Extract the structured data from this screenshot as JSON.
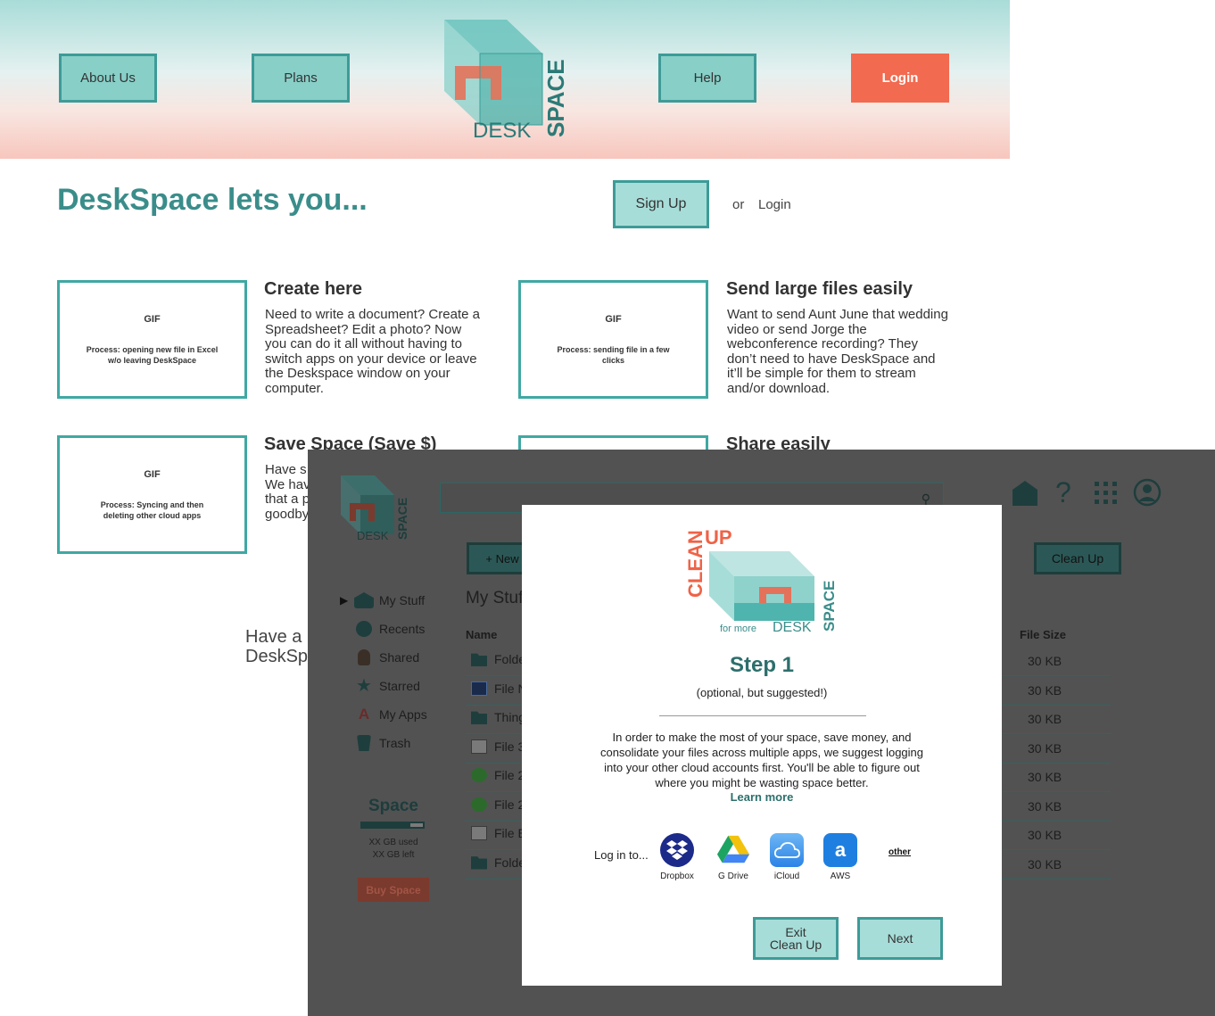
{
  "nav": {
    "about": "About Us",
    "plans": "Plans",
    "help": "Help",
    "login": "Login"
  },
  "logo": {
    "word_a": "DESK",
    "word_b": "SPACE"
  },
  "hero": {
    "title": "DeskSpace lets you...",
    "signup": "Sign Up",
    "or": "or",
    "login": "Login"
  },
  "features": [
    {
      "title": "Create here",
      "text": "Need to write a document? Create a Spreadsheet? Edit a photo? Now you can do it all without having to switch apps on your device or leave the Deskspace window on your computer.",
      "gif_label": "GIF",
      "gif_caption": "Process: opening new file in Excel w/o leaving DeskSpace"
    },
    {
      "title": "Send large files easily",
      "text": "Want to send Aunt June that wedding video or send Jorge the webconference recording? They don’t need to have DeskSpace and it’ll be simple for them to stream and/or download.",
      "gif_label": "GIF",
      "gif_caption": "Process: sending file in a few clicks"
    },
    {
      "title": "Save Space (Save $)",
      "text": "Have s\nWe hav\nthat a p\ngoodby",
      "gif_label": "GIF",
      "gif_caption": "Process: Syncing and then deleting other cloud apps"
    },
    {
      "title": "Share easily"
    }
  ],
  "have_text": "Have a\nDeskSp",
  "app": {
    "new_button": "+ New",
    "cleanup_button": "Clean Up",
    "sidebar": [
      {
        "label": "My Stuff",
        "icon": "home-icon"
      },
      {
        "label": "Recents",
        "icon": "clock-icon"
      },
      {
        "label": "Shared",
        "icon": "person-icon"
      },
      {
        "label": "Starred",
        "icon": "star-icon"
      },
      {
        "label": "My Apps",
        "icon": "apps-icon"
      },
      {
        "label": "Trash",
        "icon": "trash-icon"
      }
    ],
    "section_title": "My Stuff",
    "col_name": "Name",
    "col_size": "File Size",
    "rows": [
      {
        "name": "Folde",
        "size": "30 KB",
        "icon": "folder-icon"
      },
      {
        "name": "File N",
        "size": "30 KB",
        "icon": "photoshop-file-icon"
      },
      {
        "name": "Thing",
        "size": "30 KB",
        "icon": "folder-icon"
      },
      {
        "name": "File 3",
        "size": "30 KB",
        "icon": "document-icon"
      },
      {
        "name": "File 2",
        "size": "30 KB",
        "icon": "quickbooks-icon"
      },
      {
        "name": "File 2",
        "size": "30 KB",
        "icon": "quickbooks-icon"
      },
      {
        "name": "File E",
        "size": "30 KB",
        "icon": "document-icon"
      },
      {
        "name": "Folde",
        "size": "30 KB",
        "icon": "folder-icon"
      }
    ],
    "space": {
      "title": "Space",
      "used": "XX GB used",
      "left": "XX GB left",
      "buy": "Buy Space",
      "fill_fraction": 0.8
    }
  },
  "modal": {
    "logo_clean": "CLEAN",
    "logo_up": "UP",
    "logo_for_more": "for more",
    "logo_desk": "DESK",
    "logo_space": "SPACE",
    "step_title": "Step 1",
    "step_sub": "(optional, but suggested!)",
    "body": "In order to make the most of your space, save money, and consolidate your files across multiple apps, we suggest logging into your other cloud accounts first. You'll be able to figure out where you might be wasting space better.",
    "learn_more": "Learn more",
    "login_to": "Log in to...",
    "services": [
      {
        "label": "Dropbox",
        "icon": "dropbox-icon"
      },
      {
        "label": "G Drive",
        "icon": "gdrive-icon"
      },
      {
        "label": "iCloud",
        "icon": "icloud-icon"
      },
      {
        "label": "AWS",
        "icon": "aws-icon"
      }
    ],
    "other": "other",
    "exit_button": "Exit\nClean Up",
    "next_button": "Next"
  },
  "colors": {
    "teal_accent": "#3d9b98",
    "teal_light": "#a7ddd8",
    "login_red": "#f26a50",
    "dim_overlay": "#525252"
  }
}
